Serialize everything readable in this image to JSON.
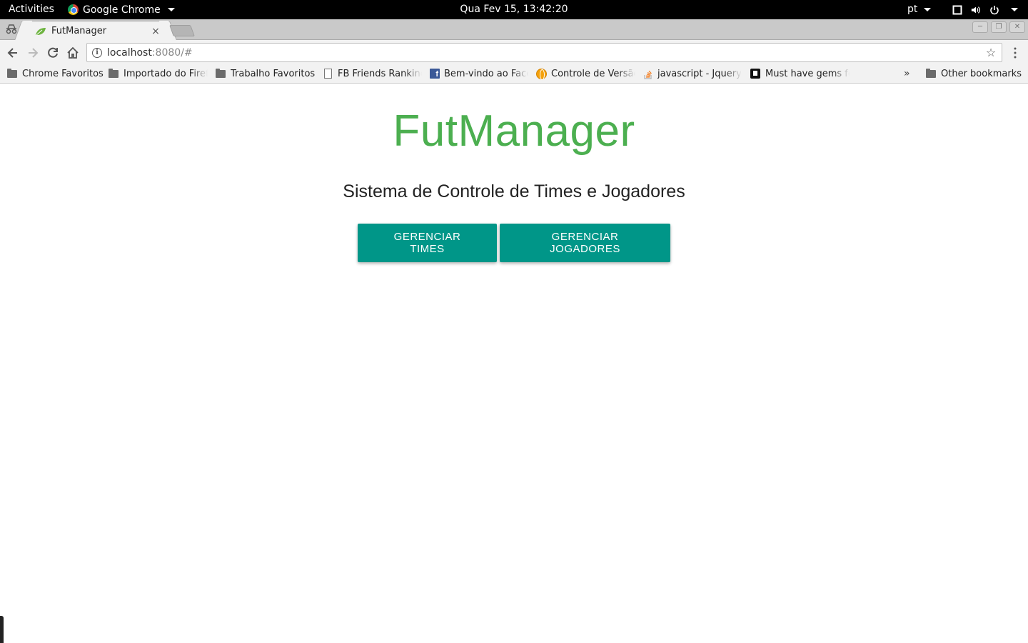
{
  "desktop": {
    "activities": "Activities",
    "app_name": "Google Chrome",
    "clock": "Qua Fev 15, 13:42:20",
    "language": "pt",
    "icons": [
      "screen-icon",
      "volume-icon",
      "power-icon"
    ]
  },
  "browser": {
    "tab": {
      "title": "FutManager",
      "favicon": "spring-leaf-icon",
      "close": "×"
    },
    "url": {
      "host": "localhost",
      "rest": ":8080/#"
    },
    "bookmarks": [
      {
        "label": "Chrome Favoritos",
        "icon": "folder-icon"
      },
      {
        "label": "Importado do Firef",
        "icon": "folder-icon"
      },
      {
        "label": "Trabalho Favoritos",
        "icon": "folder-icon"
      },
      {
        "label": "FB Friends Rankinc",
        "icon": "page-icon"
      },
      {
        "label": "Bem-vindo ao Face",
        "icon": "facebook-icon"
      },
      {
        "label": "Controle de Versão",
        "icon": "globe-icon"
      },
      {
        "label": "javascript - Jquery",
        "icon": "stackoverflow-icon"
      },
      {
        "label": "Must have gems fo",
        "icon": "gem-icon"
      }
    ],
    "bookmarks_overflow": "»",
    "other_bookmarks": "Other bookmarks"
  },
  "page": {
    "title": "FutManager",
    "subtitle": "Sistema de Controle de Times e Jogadores",
    "buttons": {
      "times": "GERENCIAR TIMES",
      "jogadores": "GERENCIAR JOGADORES"
    }
  },
  "colors": {
    "title": "#4caf50",
    "button": "#009688",
    "topbar": "#000000"
  }
}
